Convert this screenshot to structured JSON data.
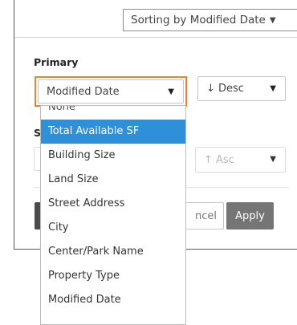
{
  "header": {
    "sort_label": "Sorting by Modified Date"
  },
  "primary": {
    "label": "Primary",
    "field_value": "Modified Date",
    "direction_value": "↓ Desc"
  },
  "secondary": {
    "label_visible": "S",
    "direction_value": "↑ Asc"
  },
  "buttons": {
    "cancel_label": "ncel",
    "apply_label": "Apply"
  },
  "dropdown": {
    "options": [
      "None",
      "Total Available SF",
      "Building Size",
      "Land Size",
      "Street Address",
      "City",
      "Center/Park Name",
      "Property Type",
      "Modified Date"
    ],
    "highlighted": "Total Available SF"
  },
  "colors": {
    "focus_ring": "#f07f33",
    "highlight": "#2f8fd9",
    "apply_button": "#757575"
  },
  "icons": {
    "caret": "chevron-down-icon"
  }
}
